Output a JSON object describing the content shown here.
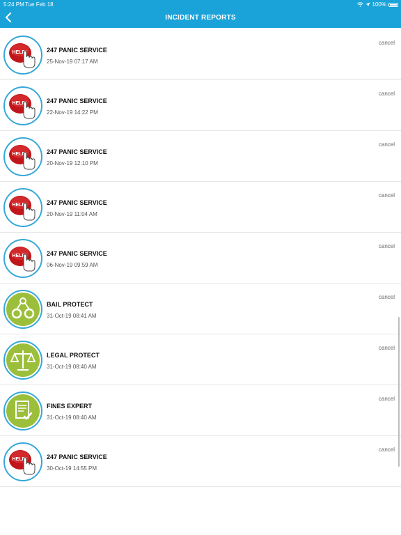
{
  "status_bar": {
    "time": "5:24 PM",
    "date": "Tue Feb 18",
    "battery": "100%"
  },
  "header": {
    "title": "INCIDENT REPORTS"
  },
  "reports": [
    {
      "name": "247 PANIC SERVICE",
      "datetime": "25-Nov-19 07:17 AM",
      "icon": "help-button-icon",
      "action": "cancel"
    },
    {
      "name": "247 PANIC SERVICE",
      "datetime": "22-Nov-19 14:22 PM",
      "icon": "help-button-icon",
      "action": "cancel"
    },
    {
      "name": "247 PANIC SERVICE",
      "datetime": "20-Nov-19 12:10 PM",
      "icon": "help-button-icon",
      "action": "cancel"
    },
    {
      "name": "247 PANIC SERVICE",
      "datetime": "20-Nov-19 11:04 AM",
      "icon": "help-button-icon",
      "action": "cancel"
    },
    {
      "name": "247 PANIC SERVICE",
      "datetime": "06-Nov-19 09:59 AM",
      "icon": "help-button-icon",
      "action": "cancel"
    },
    {
      "name": "BAIL PROTECT",
      "datetime": "31-Oct-19 08:41 AM",
      "icon": "handcuffs-icon",
      "action": "cancel"
    },
    {
      "name": "LEGAL PROTECT",
      "datetime": "31-Oct-19 08:40 AM",
      "icon": "scales-icon",
      "action": "cancel"
    },
    {
      "name": "FINES EXPERT",
      "datetime": "31-Oct-19 08:40 AM",
      "icon": "document-check-icon",
      "action": "cancel"
    },
    {
      "name": "247 PANIC SERVICE",
      "datetime": "30-Oct-19 14:55 PM",
      "icon": "help-button-icon",
      "action": "cancel"
    }
  ],
  "help_badge_text": "HELP!",
  "colors": {
    "header": "#1aa3d8",
    "ring": "#35a8d8",
    "help_red": "#c0161b",
    "service_green": "#9cbf3b"
  }
}
